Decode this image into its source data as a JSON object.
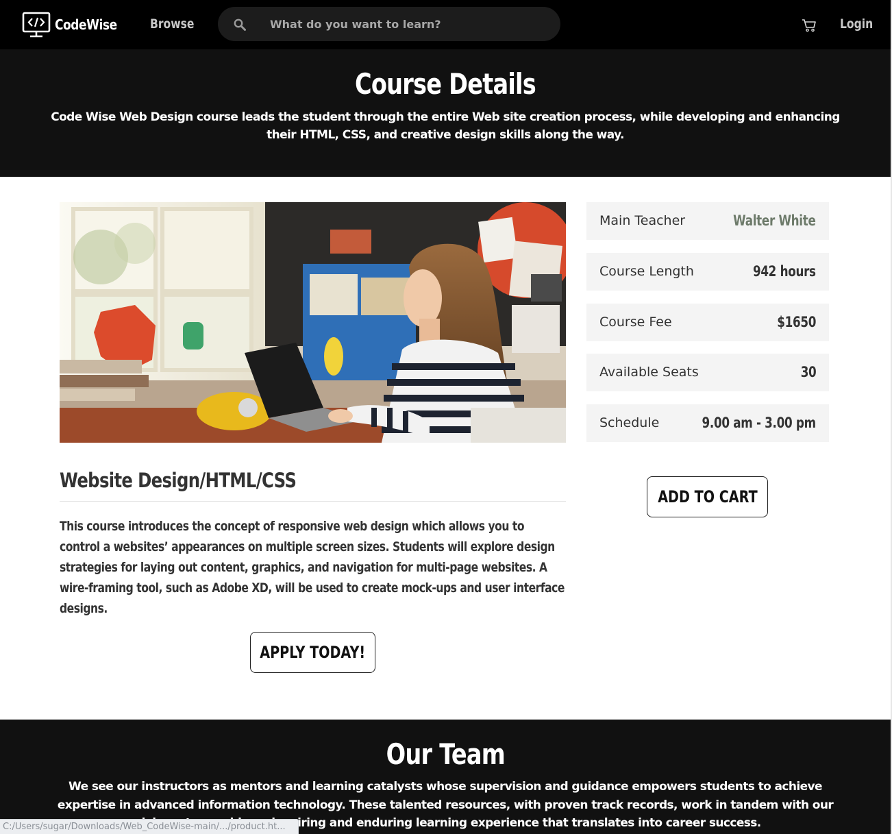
{
  "navbar": {
    "brand_name": "CodeWise",
    "brand_icon": "monitor-code-icon",
    "browse_label": "Browse",
    "search_placeholder": "What do you want to learn?",
    "search_icon": "search-icon",
    "cart_icon": "cart-icon",
    "login_label": "Login"
  },
  "hero": {
    "title": "Course Details",
    "subtitle": "Code Wise Web Design course leads the student through the entire Web site creation process, while developing and enhancing their HTML, CSS, and creative design skills along the way."
  },
  "course": {
    "image_description": "woman-working-on-laptop-image",
    "title": "Website Design/HTML/CSS",
    "description": "This course introduces the concept of responsive web design which allows you to control a websites’ appearances on multiple screen sizes. Students will explore design strategies for laying out content, graphics, and navigation for multi-page websites. A wire-framing tool, such as Adobe XD, will be used to create mock-ups and user interface designs.",
    "apply_label": "APPLY TODAY!"
  },
  "info": [
    {
      "label": "Main Teacher",
      "value": "Walter White"
    },
    {
      "label": "Course Length",
      "value": "942 hours"
    },
    {
      "label": "Course Fee",
      "value": "$1650"
    },
    {
      "label": "Available Seats",
      "value": "30"
    },
    {
      "label": "Schedule",
      "value": "9.00 am - 3.00 pm"
    }
  ],
  "add_to_cart_label": "ADD TO CART",
  "team": {
    "title": "Our Team",
    "text": "We see our instructors as mentors and learning catalysts whose supervision and guidance empowers students to achieve expertise in advanced information technology. These talented resources, with proven track records, work in tandem with our advisors to provide an inspiring and enduring learning experience that translates into career success."
  },
  "status_bar": {
    "url": "C:/Users/sugar/Downloads/Web_CodeWise-main/.../product.ht..."
  },
  "colors": {
    "nav_bg": "#000000",
    "hero_bg": "#111111",
    "info_bg": "#f4f4f4",
    "teacher_name": "#6d7a6a"
  }
}
